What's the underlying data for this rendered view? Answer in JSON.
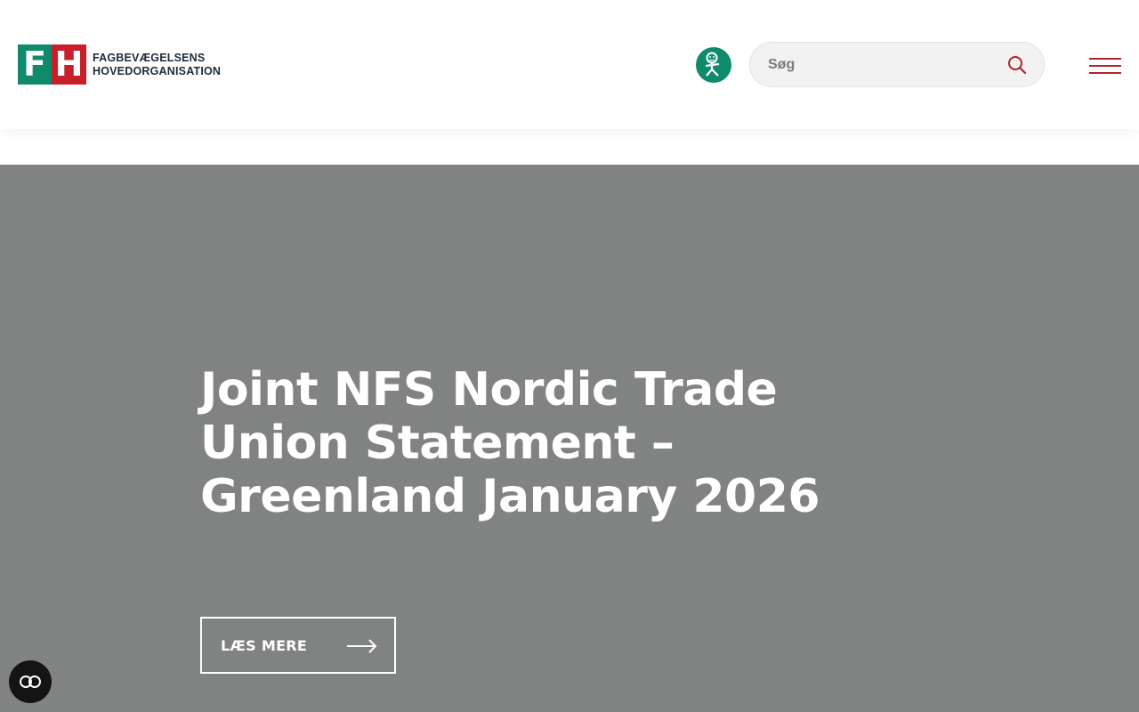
{
  "header": {
    "logo": {
      "mark_left": "F",
      "mark_right": "H",
      "line1": "FAGBEVÆGELSENS",
      "line2": "HOVEDORGANISATION"
    },
    "accessibility_icon": "easy-read-icon",
    "search": {
      "placeholder": "Søg",
      "icon": "search-icon"
    },
    "menu_icon": "hamburger-menu-icon"
  },
  "hero": {
    "title": "Joint NFS Nordic Trade Union Statement – Greenland January 2026",
    "button_label": "LÆS MERE",
    "button_icon": "arrow-right-icon"
  },
  "cookie_icon": "cookie-consent-icon",
  "colors": {
    "brand_green": "#0f8a6a",
    "brand_red": "#c8202b",
    "hero_background": "#818282",
    "dark_text": "#1c2b3a"
  }
}
